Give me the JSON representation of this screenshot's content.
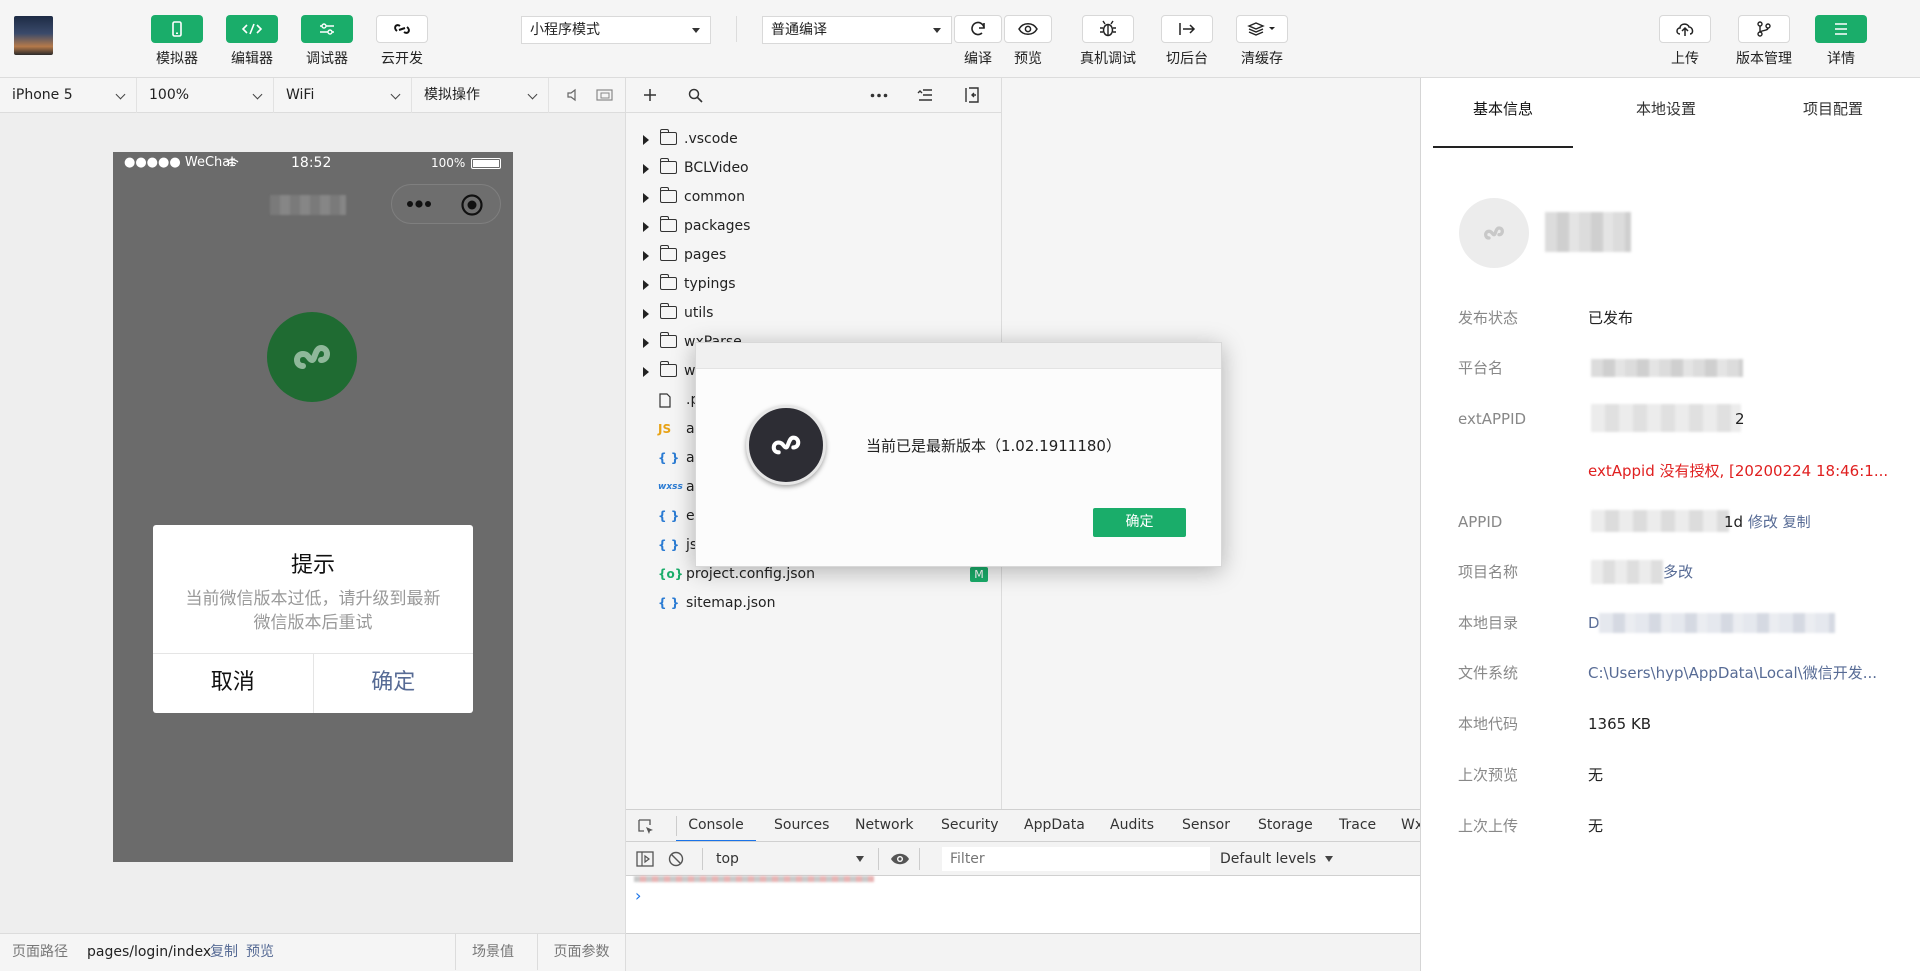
{
  "toolbar": {
    "simulator": "模拟器",
    "editor": "编辑器",
    "debugger": "调试器",
    "cloud": "云开发",
    "mode_select": "小程序模式",
    "compile_select": "普通编译",
    "compile": "编译",
    "preview": "预览",
    "real_debug": "真机调试",
    "background": "切后台",
    "clear_cache": "清缓存",
    "upload": "上传",
    "version": "版本管理",
    "details": "详情"
  },
  "simbar": {
    "device": "iPhone 5",
    "zoom": "100%",
    "network": "WiFi",
    "sim_ops": "模拟操作"
  },
  "phone": {
    "carrier": "●●●●● WeChat",
    "time": "18:52",
    "battery": "100%",
    "dialog_title": "提示",
    "dialog_message": "当前微信版本过低，请升级到最新微信版本后重试",
    "cancel": "取消",
    "confirm": "确定"
  },
  "pathbar": {
    "label": "页面路径",
    "path": "pages/login/index",
    "copy": "复制",
    "preview": "预览",
    "scene": "场景值",
    "params": "页面参数"
  },
  "files": [
    {
      "name": ".vscode"
    },
    {
      "name": "BCLVideo"
    },
    {
      "name": "common"
    },
    {
      "name": "packages"
    },
    {
      "name": "pages"
    },
    {
      "name": "typings"
    },
    {
      "name": "utils"
    },
    {
      "name": "wxParse"
    },
    {
      "name": "wx"
    },
    {
      "name": ".p"
    },
    {
      "name": "ap"
    },
    {
      "name": "ap"
    },
    {
      "name": "ap"
    },
    {
      "name": "ex"
    },
    {
      "name": "js"
    },
    {
      "name": "project.config.json",
      "badge": "M"
    },
    {
      "name": "sitemap.json"
    }
  ],
  "devtools": {
    "tabs": [
      "Console",
      "Sources",
      "Network",
      "Security",
      "AppData",
      "Audits",
      "Sensor",
      "Storage",
      "Trace",
      "Wx"
    ],
    "context": "top",
    "filter_placeholder": "Filter",
    "levels": "Default levels",
    "prompt": "›"
  },
  "modal": {
    "message": "当前已是最新版本（1.02.1911180）",
    "ok": "确定"
  },
  "details": {
    "tabs": [
      "基本信息",
      "本地设置",
      "项目配置"
    ],
    "rows": {
      "publish_status_label": "发布状态",
      "publish_status": "已发布",
      "platform_label": "平台名",
      "extappid_label": "extAPPID",
      "extappid_suffix": "2",
      "extappid_error": "extAppid 没有授权, [20200224 18:46:1...",
      "appid_label": "APPID",
      "appid_suffix": "1d",
      "modify": "修改",
      "copy": "复制",
      "project_name_label": "项目名称",
      "project_modify": "多改",
      "local_dir_label": "本地目录",
      "local_dir_prefix": "D",
      "filesystem_label": "文件系统",
      "filesystem": "C:\\Users\\hyp\\AppData\\Local\\微信开发...",
      "local_code_label": "本地代码",
      "local_code": "1365 KB",
      "last_preview_label": "上次预览",
      "last_preview": "无",
      "last_upload_label": "上次上传",
      "last_upload": "无"
    }
  },
  "colors": {
    "green": "#1aad6a",
    "link": "#576b95",
    "error": "#e02020"
  }
}
